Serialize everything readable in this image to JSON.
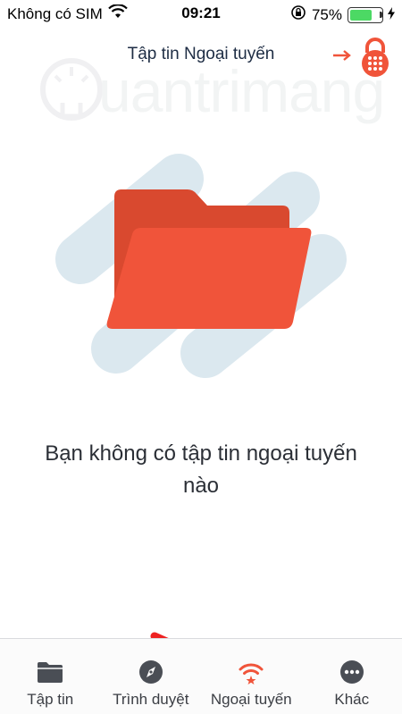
{
  "status_bar": {
    "carrier": "Không có SIM",
    "time": "09:21",
    "battery_percent": "75%",
    "battery_level": 0.75,
    "icons": [
      "wifi-icon",
      "rotation-lock-icon",
      "battery-icon",
      "charging-icon"
    ]
  },
  "header": {
    "title": "Tập tin Ngoại tuyến",
    "lock_icon": "lock-icon"
  },
  "watermark": {
    "text": "uantrimang"
  },
  "empty_state": {
    "message": "Bạn không có tập tin ngoại tuyến nào",
    "illustration_icon": "folder-icon"
  },
  "tabs": [
    {
      "label": "Tập tin",
      "icon": "folder-icon",
      "active": false
    },
    {
      "label": "Trình duyệt",
      "icon": "compass-icon",
      "active": false
    },
    {
      "label": "Ngoại tuyến",
      "icon": "offline-wifi-icon",
      "active": true
    },
    {
      "label": "Khác",
      "icon": "more-icon",
      "active": false
    }
  ],
  "colors": {
    "accent": "#f0543a",
    "folder_dark": "#d9492f",
    "blob": "#dbe8ef",
    "title": "#1e2d44",
    "arrow": "#ee2222",
    "tab_icon": "#4a4e55"
  }
}
